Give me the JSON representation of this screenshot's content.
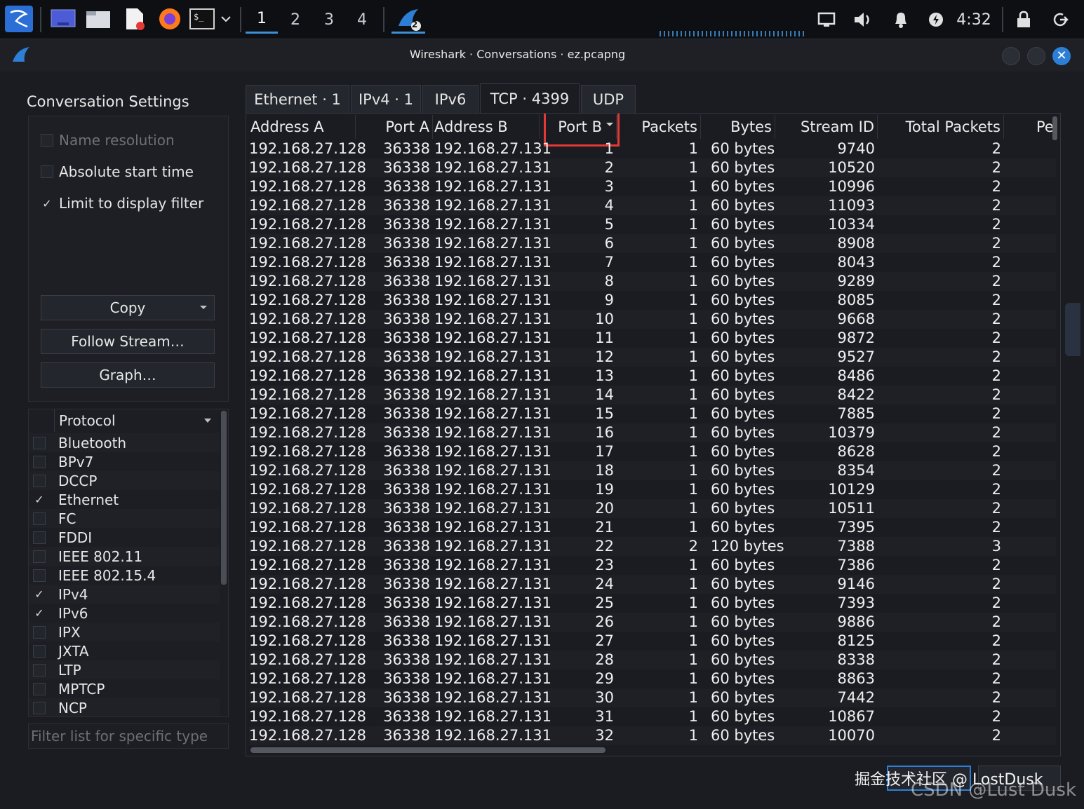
{
  "taskbar": {
    "workspaces": [
      "1",
      "2",
      "3",
      "4"
    ],
    "active_workspace": "1",
    "wireshark_badge": "2",
    "clock": "4:32"
  },
  "window": {
    "title": "Wireshark · Conversations · ez.pcapng"
  },
  "settings": {
    "title": "Conversation Settings",
    "name_resolution": "Name resolution",
    "absolute_start_time": "Absolute start time",
    "limit_to_display_filter": "Limit to display filter",
    "check_mark": "✓",
    "copy_label": "Copy",
    "follow_stream_label": "Follow Stream…",
    "graph_label": "Graph…"
  },
  "protocols": {
    "header": "Protocol",
    "items": [
      {
        "name": "Bluetooth",
        "checked": false
      },
      {
        "name": "BPv7",
        "checked": false
      },
      {
        "name": "DCCP",
        "checked": false
      },
      {
        "name": "Ethernet",
        "checked": true
      },
      {
        "name": "FC",
        "checked": false
      },
      {
        "name": "FDDI",
        "checked": false
      },
      {
        "name": "IEEE 802.11",
        "checked": false
      },
      {
        "name": "IEEE 802.15.4",
        "checked": false
      },
      {
        "name": "IPv4",
        "checked": true
      },
      {
        "name": "IPv6",
        "checked": true
      },
      {
        "name": "IPX",
        "checked": false
      },
      {
        "name": "JXTA",
        "checked": false
      },
      {
        "name": "LTP",
        "checked": false
      },
      {
        "name": "MPTCP",
        "checked": false
      },
      {
        "name": "NCP",
        "checked": false
      }
    ],
    "filter_placeholder": "Filter list for specific type"
  },
  "tabs": [
    {
      "label": "Ethernet · 1"
    },
    {
      "label": "IPv4 · 1"
    },
    {
      "label": "IPv6"
    },
    {
      "label": "TCP · 4399",
      "active": true
    },
    {
      "label": "UDP"
    }
  ],
  "table": {
    "columns": [
      "Address A",
      "Port A",
      "Address B",
      "Port B",
      "Packets",
      "Bytes",
      "Stream ID",
      "Total Packets",
      "Pe"
    ],
    "address_a": "192.168.27.128",
    "port_a": "36338",
    "address_b": "192.168.27.131",
    "rows": [
      {
        "port_b": "1",
        "packets": "1",
        "bytes": "60 bytes",
        "stream_id": "9740",
        "total": "2"
      },
      {
        "port_b": "2",
        "packets": "1",
        "bytes": "60 bytes",
        "stream_id": "10520",
        "total": "2"
      },
      {
        "port_b": "3",
        "packets": "1",
        "bytes": "60 bytes",
        "stream_id": "10996",
        "total": "2"
      },
      {
        "port_b": "4",
        "packets": "1",
        "bytes": "60 bytes",
        "stream_id": "11093",
        "total": "2"
      },
      {
        "port_b": "5",
        "packets": "1",
        "bytes": "60 bytes",
        "stream_id": "10334",
        "total": "2"
      },
      {
        "port_b": "6",
        "packets": "1",
        "bytes": "60 bytes",
        "stream_id": "8908",
        "total": "2"
      },
      {
        "port_b": "7",
        "packets": "1",
        "bytes": "60 bytes",
        "stream_id": "8043",
        "total": "2"
      },
      {
        "port_b": "8",
        "packets": "1",
        "bytes": "60 bytes",
        "stream_id": "9289",
        "total": "2"
      },
      {
        "port_b": "9",
        "packets": "1",
        "bytes": "60 bytes",
        "stream_id": "8085",
        "total": "2"
      },
      {
        "port_b": "10",
        "packets": "1",
        "bytes": "60 bytes",
        "stream_id": "9668",
        "total": "2"
      },
      {
        "port_b": "11",
        "packets": "1",
        "bytes": "60 bytes",
        "stream_id": "9872",
        "total": "2"
      },
      {
        "port_b": "12",
        "packets": "1",
        "bytes": "60 bytes",
        "stream_id": "9527",
        "total": "2"
      },
      {
        "port_b": "13",
        "packets": "1",
        "bytes": "60 bytes",
        "stream_id": "8486",
        "total": "2"
      },
      {
        "port_b": "14",
        "packets": "1",
        "bytes": "60 bytes",
        "stream_id": "8422",
        "total": "2"
      },
      {
        "port_b": "15",
        "packets": "1",
        "bytes": "60 bytes",
        "stream_id": "7885",
        "total": "2"
      },
      {
        "port_b": "16",
        "packets": "1",
        "bytes": "60 bytes",
        "stream_id": "10379",
        "total": "2"
      },
      {
        "port_b": "17",
        "packets": "1",
        "bytes": "60 bytes",
        "stream_id": "8628",
        "total": "2"
      },
      {
        "port_b": "18",
        "packets": "1",
        "bytes": "60 bytes",
        "stream_id": "8354",
        "total": "2"
      },
      {
        "port_b": "19",
        "packets": "1",
        "bytes": "60 bytes",
        "stream_id": "10129",
        "total": "2"
      },
      {
        "port_b": "20",
        "packets": "1",
        "bytes": "60 bytes",
        "stream_id": "10511",
        "total": "2"
      },
      {
        "port_b": "21",
        "packets": "1",
        "bytes": "60 bytes",
        "stream_id": "7395",
        "total": "2"
      },
      {
        "port_b": "22",
        "packets": "2",
        "bytes": "120 bytes",
        "stream_id": "7388",
        "total": "3"
      },
      {
        "port_b": "23",
        "packets": "1",
        "bytes": "60 bytes",
        "stream_id": "7386",
        "total": "2"
      },
      {
        "port_b": "24",
        "packets": "1",
        "bytes": "60 bytes",
        "stream_id": "9146",
        "total": "2"
      },
      {
        "port_b": "25",
        "packets": "1",
        "bytes": "60 bytes",
        "stream_id": "7393",
        "total": "2"
      },
      {
        "port_b": "26",
        "packets": "1",
        "bytes": "60 bytes",
        "stream_id": "9886",
        "total": "2"
      },
      {
        "port_b": "27",
        "packets": "1",
        "bytes": "60 bytes",
        "stream_id": "8125",
        "total": "2"
      },
      {
        "port_b": "28",
        "packets": "1",
        "bytes": "60 bytes",
        "stream_id": "8338",
        "total": "2"
      },
      {
        "port_b": "29",
        "packets": "1",
        "bytes": "60 bytes",
        "stream_id": "8863",
        "total": "2"
      },
      {
        "port_b": "30",
        "packets": "1",
        "bytes": "60 bytes",
        "stream_id": "7442",
        "total": "2"
      },
      {
        "port_b": "31",
        "packets": "1",
        "bytes": "60 bytes",
        "stream_id": "10867",
        "total": "2"
      },
      {
        "port_b": "32",
        "packets": "1",
        "bytes": "60 bytes",
        "stream_id": "10070",
        "total": "2"
      }
    ]
  },
  "watermark": {
    "line1": "掘金技术社区 @ LostDusk",
    "line2": "CSDN @Lust Dusk"
  },
  "colors": {
    "accent": "#2d7fd6",
    "highlight": "#e53935"
  }
}
